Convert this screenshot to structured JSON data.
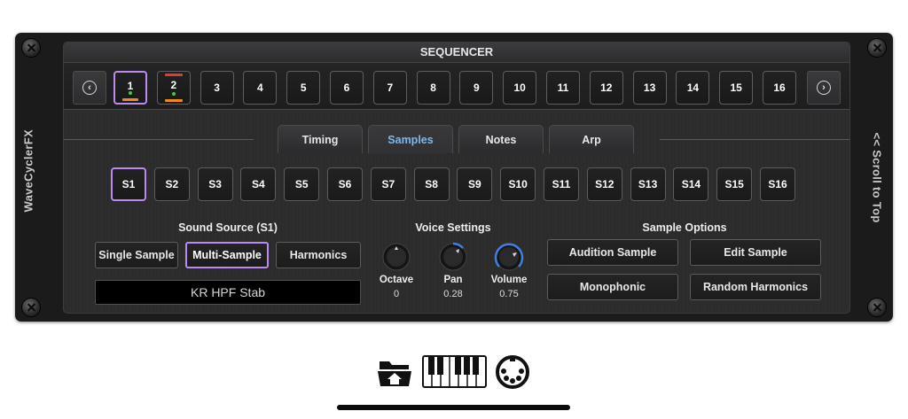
{
  "app": {
    "side_label_left": "WaveCyclerFX",
    "side_label_right": "<< Scroll to Top"
  },
  "sequencer": {
    "title": "SEQUENCER",
    "prev_label": "‹",
    "next_label": "›",
    "steps": [
      {
        "label": "1"
      },
      {
        "label": "2"
      },
      {
        "label": "3"
      },
      {
        "label": "4"
      },
      {
        "label": "5"
      },
      {
        "label": "6"
      },
      {
        "label": "7"
      },
      {
        "label": "8"
      },
      {
        "label": "9"
      },
      {
        "label": "10"
      },
      {
        "label": "11"
      },
      {
        "label": "12"
      },
      {
        "label": "13"
      },
      {
        "label": "14"
      },
      {
        "label": "15"
      },
      {
        "label": "16"
      }
    ]
  },
  "tabs": [
    {
      "label": "Timing"
    },
    {
      "label": "Samples"
    },
    {
      "label": "Notes"
    },
    {
      "label": "Arp"
    }
  ],
  "sample_slots": [
    "S1",
    "S2",
    "S3",
    "S4",
    "S5",
    "S6",
    "S7",
    "S8",
    "S9",
    "S10",
    "S11",
    "S12",
    "S13",
    "S14",
    "S15",
    "S16"
  ],
  "sound_source": {
    "title": "Sound Source (S1)",
    "buttons": [
      {
        "label": "Single Sample"
      },
      {
        "label": "Multi-Sample"
      },
      {
        "label": "Harmonics"
      }
    ],
    "sample_name": "KR HPF Stab"
  },
  "voice_settings": {
    "title": "Voice Settings",
    "knobs": [
      {
        "label": "Octave",
        "value": "0"
      },
      {
        "label": "Pan",
        "value": "0.28"
      },
      {
        "label": "Volume",
        "value": "0.75"
      }
    ]
  },
  "sample_options": {
    "title": "Sample Options",
    "buttons": [
      {
        "label": "Audition Sample"
      },
      {
        "label": "Edit Sample"
      },
      {
        "label": "Monophonic"
      },
      {
        "label": "Random Harmonics"
      }
    ]
  },
  "colors": {
    "accent_selected": "#b98bf0",
    "tab_selected_text": "#7db8ee",
    "knob_arc": "#3f7fe0",
    "step_dot": "#3ecf38",
    "step_bar_bottom": "#f0891e",
    "step_bar_top": "#e63a2c"
  },
  "dock": {
    "icons": [
      "folder-icon",
      "piano-keyboard-icon",
      "midi-port-icon"
    ]
  }
}
